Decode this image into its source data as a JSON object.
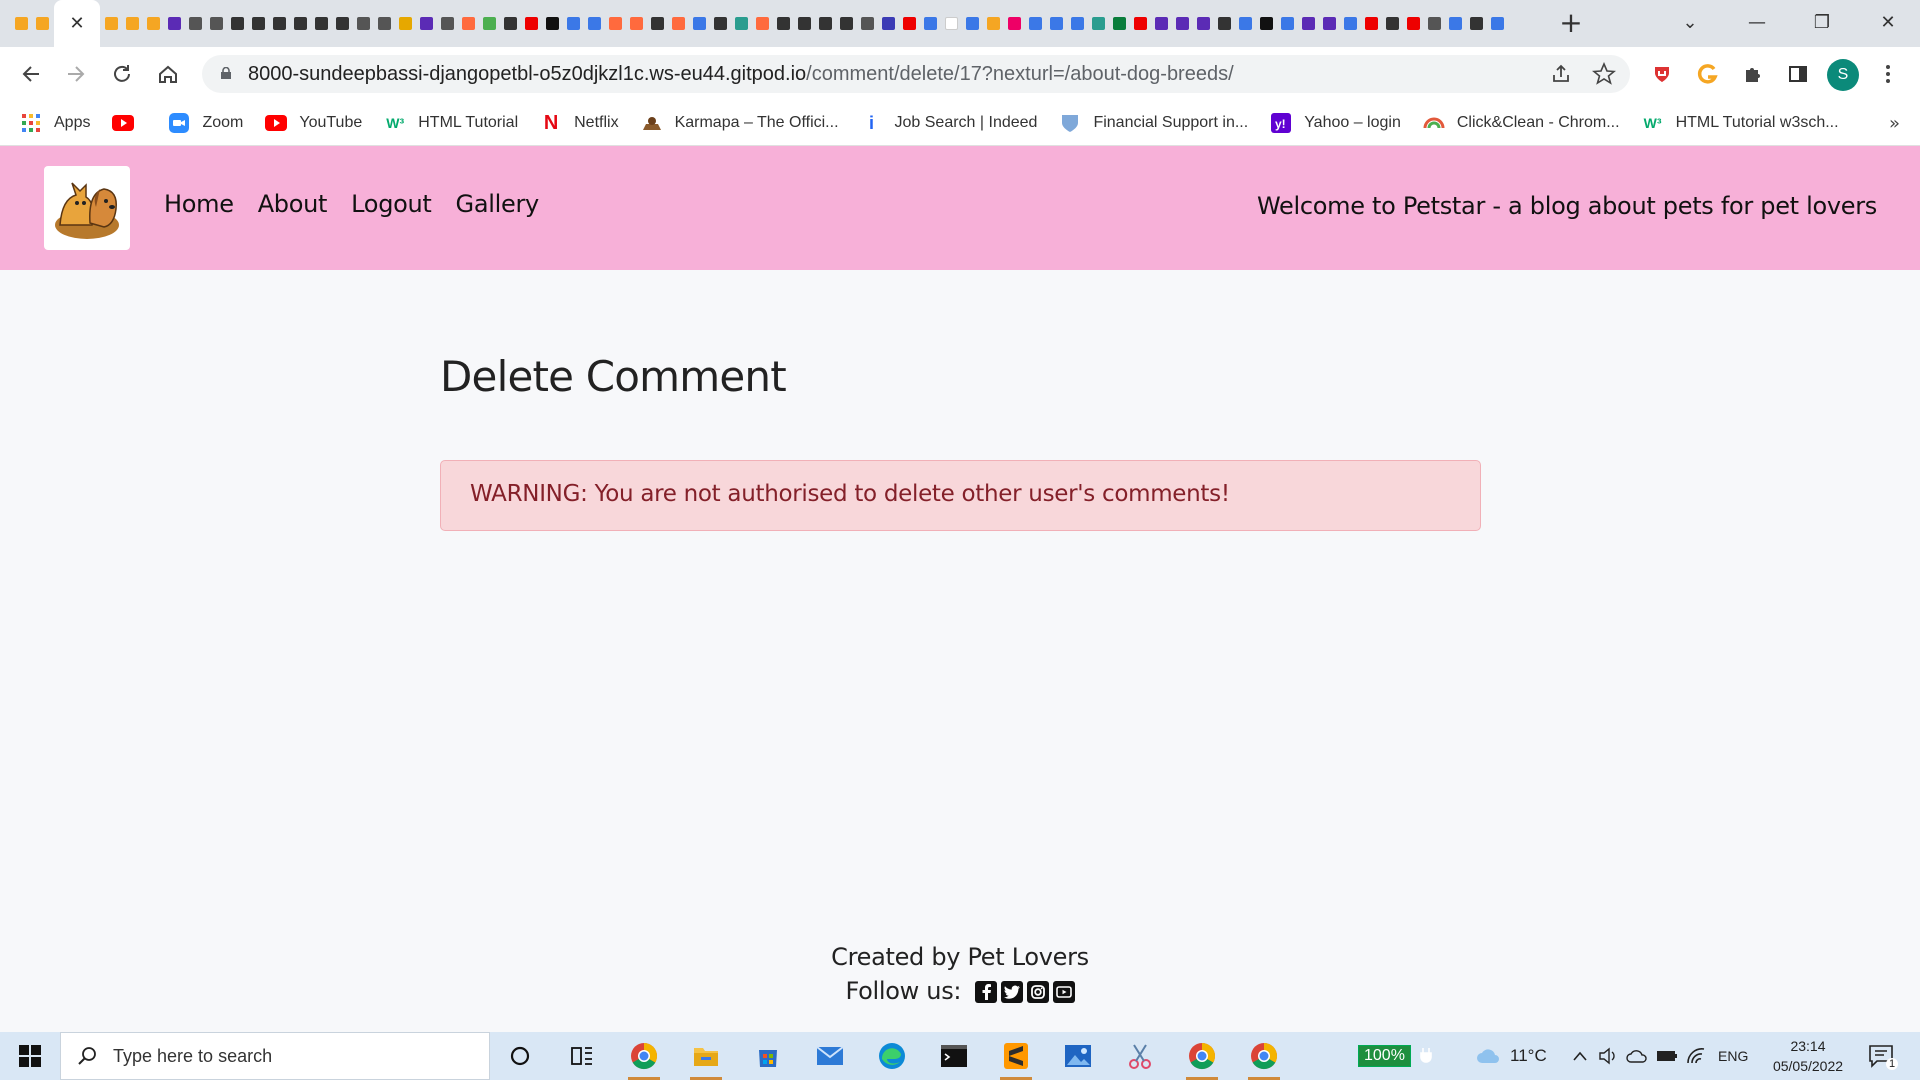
{
  "browser": {
    "active_tab_close": "✕",
    "new_tab": "+",
    "window_controls": {
      "dropdown": "⌄",
      "minimize": "—",
      "restore": "❐",
      "close": "✕"
    },
    "url_host": "8000-sundeepbassi-djangopetbl-o5z0djkzl1c.ws-eu44.gitpod.io",
    "url_path": "/comment/delete/17?nexturl=/about-dog-breeds/",
    "profile_initial": "S",
    "tab_favicon_colors": [
      "#f5a623",
      "#f5a623",
      "#f5a623",
      "#5b2bb5",
      "#555",
      "#555",
      "#333",
      "#333",
      "#333",
      "#333",
      "#333",
      "#333",
      "#555",
      "#555",
      "#e6a800",
      "#5b2bb5",
      "#555",
      "#ff6a3d",
      "#4caf50",
      "#333",
      "#e00",
      "#111",
      "#3b78e7",
      "#3b78e7",
      "#ff6a3d",
      "#ff6a3d",
      "#333",
      "#ff6a3d",
      "#3b78e7",
      "#333",
      "#2a9d8f",
      "#ff6a3d",
      "#333",
      "#333",
      "#333",
      "#333",
      "#555",
      "#3b3bb5",
      "#e00",
      "#3b78e7",
      "#ffffff",
      "#3b78e7",
      "#f5a623",
      "#e06",
      "#3b78e7",
      "#3b78e7",
      "#3b78e7",
      "#2a9d8f",
      "#0a7d3c",
      "#e00",
      "#5b2bb5",
      "#5b2bb5",
      "#5b2bb5",
      "#333",
      "#3b78e7",
      "#111",
      "#3b78e7",
      "#5b2bb5",
      "#5b2bb5",
      "#3b78e7",
      "#e00",
      "#333",
      "#e00",
      "#555",
      "#3b78e7",
      "#333",
      "#3b78e7"
    ]
  },
  "bookmarks": [
    {
      "label": "Apps",
      "icon": "apps-grid-icon",
      "color": "#e8453c"
    },
    {
      "label": "",
      "icon": "youtube-icon",
      "color": "#ff0000"
    },
    {
      "label": "Zoom",
      "icon": "zoom-icon",
      "color": "#2d8cff"
    },
    {
      "label": "YouTube",
      "icon": "youtube-icon",
      "color": "#ff0000"
    },
    {
      "label": "HTML Tutorial",
      "icon": "w3schools-icon",
      "color": "#04aa6d"
    },
    {
      "label": "Netflix",
      "icon": "netflix-icon",
      "color": "#e50914"
    },
    {
      "label": "Karmapa – The Offici...",
      "icon": "karmapa-icon",
      "color": "#8a5a2b"
    },
    {
      "label": "Job Search | Indeed",
      "icon": "indeed-icon",
      "color": "#2164f3"
    },
    {
      "label": "Financial Support in...",
      "icon": "shield-icon",
      "color": "#7fa8d9"
    },
    {
      "label": "Yahoo – login",
      "icon": "yahoo-icon",
      "color": "#6001d2"
    },
    {
      "label": "Click&Clean - Chrom...",
      "icon": "clickclean-icon",
      "color": "#e2593b"
    },
    {
      "label": "HTML Tutorial w3sch...",
      "icon": "w3schools-icon",
      "color": "#04aa6d"
    }
  ],
  "bookmarks_more": "»",
  "site": {
    "nav": {
      "home": "Home",
      "about": "About",
      "logout": "Logout",
      "gallery": "Gallery"
    },
    "tagline": "Welcome to Petstar - a blog about pets for pet lovers",
    "brand_color": "#f7b0d8"
  },
  "main": {
    "title": "Delete Comment",
    "warning": "WARNING: You are not authorised to delete other user's comments!"
  },
  "footer": {
    "created_by": "Created by Pet Lovers",
    "follow_us": "Follow us:"
  },
  "taskbar": {
    "search_placeholder": "Type here to search",
    "battery": "100%",
    "temperature": "11°C",
    "language": "ENG",
    "time": "23:14",
    "date": "05/05/2022",
    "notifications": "1"
  }
}
